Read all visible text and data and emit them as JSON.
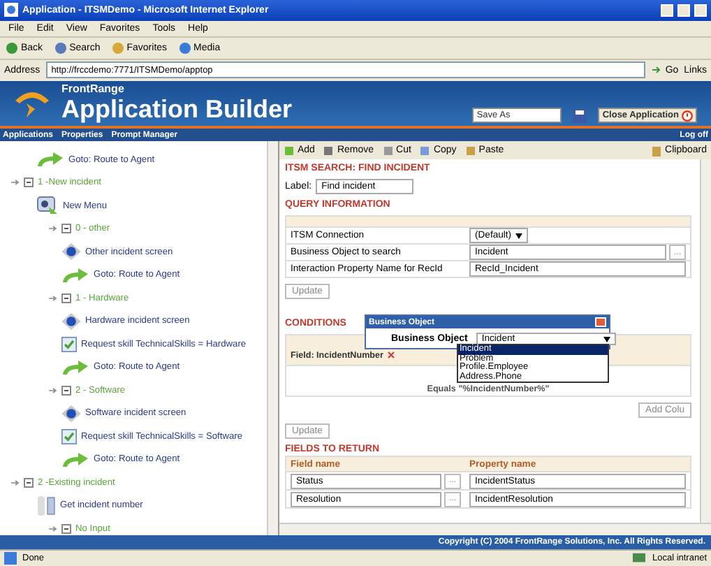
{
  "window": {
    "title": "Application - ITSMDemo - Microsoft Internet Explorer"
  },
  "menu": [
    "File",
    "Edit",
    "View",
    "Favorites",
    "Tools",
    "Help"
  ],
  "browser_toolbar": [
    "Back",
    "Search",
    "Favorites",
    "Media"
  ],
  "address": {
    "label": "Address",
    "url": "http://frccdemo:7771/ITSMDemo/apptop",
    "go": "Go",
    "links": "Links"
  },
  "banner": {
    "company": "FrontRange",
    "product": "Application Builder",
    "save_as": "Save As",
    "close": "Close Application"
  },
  "breadcrumb": [
    "Applications",
    "Properties",
    "Prompt Manager"
  ],
  "log_off": "Log off",
  "tree": [
    {
      "kind": "goto",
      "label": "Goto: Route to Agent"
    },
    {
      "kind": "branch",
      "label": "1 -New incident",
      "expanded": true,
      "children": [
        {
          "kind": "menu",
          "label": "New Menu"
        },
        {
          "kind": "branch",
          "label": "0 - other",
          "expanded": true,
          "children": [
            {
              "kind": "screen",
              "label": "Other incident screen"
            },
            {
              "kind": "goto",
              "label": "Goto: Route to Agent"
            }
          ]
        },
        {
          "kind": "branch",
          "label": "1 - Hardware",
          "expanded": true,
          "children": [
            {
              "kind": "screen",
              "label": "Hardware incident screen"
            },
            {
              "kind": "skill",
              "label": "Request skill TechnicalSkills = Hardware"
            },
            {
              "kind": "goto",
              "label": "Goto: Route to Agent"
            }
          ]
        },
        {
          "kind": "branch",
          "label": "2 - Software",
          "expanded": true,
          "children": [
            {
              "kind": "screen",
              "label": "Software incident screen"
            },
            {
              "kind": "skill",
              "label": "Request skill TechnicalSkills = Software"
            },
            {
              "kind": "goto",
              "label": "Goto: Route to Agent"
            }
          ]
        }
      ]
    },
    {
      "kind": "branch",
      "label": "2 -Existing incident",
      "expanded": true,
      "children": [
        {
          "kind": "input",
          "label": "Get incident number"
        },
        {
          "kind": "branch",
          "label": "No Input",
          "expanded": true
        }
      ]
    }
  ],
  "editor_toolbar": [
    "Add",
    "Remove",
    "Cut",
    "Copy",
    "Paste"
  ],
  "clipboard": "Clipboard",
  "editor": {
    "heading": "ITSM SEARCH: FIND INCIDENT",
    "label_caption": "Label:",
    "label_value": "Find incident",
    "query": {
      "title": "QUERY INFORMATION",
      "rows": [
        {
          "name": "ITSM Connection",
          "kind": "select",
          "value": "(Default)"
        },
        {
          "name": "Business Object to search",
          "kind": "browse",
          "value": "Incident",
          "button": "..."
        },
        {
          "name": "Interaction Property Name for RecId",
          "kind": "text",
          "value": "RecId_Incident"
        }
      ],
      "update": "Update"
    },
    "conditions": {
      "title": "CONDITIONS",
      "field": "Field: IncidentNumber",
      "operator": "Equals \"%IncidentNumber%\"",
      "add_column": "Add Colu",
      "update": "Update"
    },
    "fields": {
      "title": "FIELDS TO RETURN",
      "columns": [
        "Field name",
        "Property name"
      ],
      "rows": [
        {
          "field": "Status",
          "button": "...",
          "property": "IncidentStatus"
        },
        {
          "field": "Resolution",
          "button": "...",
          "property": "IncidentResolution"
        }
      ]
    }
  },
  "dialog": {
    "title": "Business Object",
    "label": "Business Object",
    "value": "Incident",
    "options": [
      {
        "label": "Incident",
        "selected": true
      },
      {
        "label": "Problem",
        "selected": false
      },
      {
        "label": "Profile.Employee",
        "selected": false
      },
      {
        "label": "Address.Phone",
        "selected": false
      }
    ]
  },
  "copyright": "Copyright (C) 2004 FrontRange Solutions, Inc. All Rights Reserved.",
  "status": {
    "text": "Done",
    "zone": "Local intranet"
  }
}
